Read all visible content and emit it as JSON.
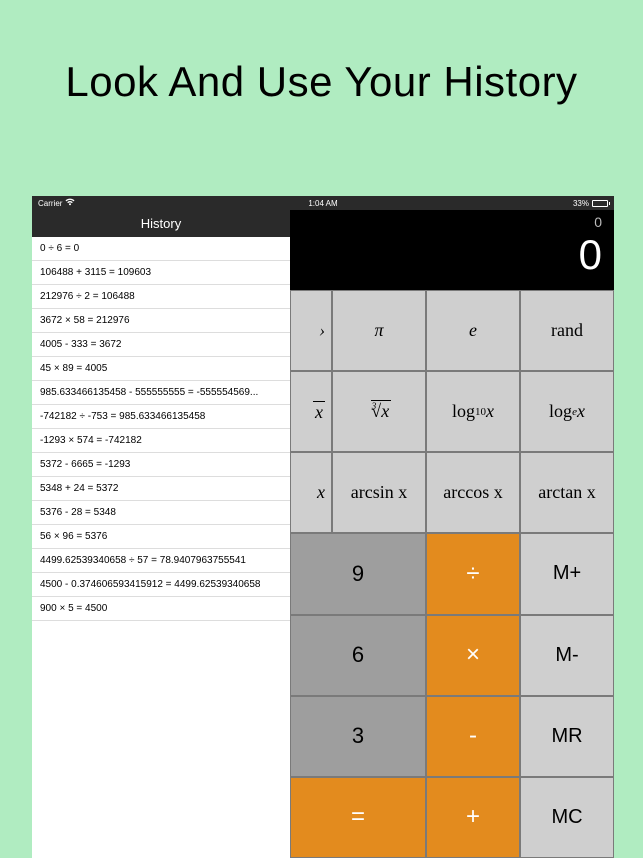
{
  "headline": "Look And Use Your History",
  "statusbar": {
    "carrier": "Carrier",
    "time": "1:04 AM",
    "battery_pct": "33%"
  },
  "history": {
    "title": "History",
    "items": [
      "0 ÷ 6 = 0",
      "106488 + 3115 = 109603",
      "212976 ÷ 2 = 106488",
      "3672 × 58 = 212976",
      "4005 - 333 = 3672",
      "45 × 89 = 4005",
      "985.633466135458 - 555555555 = -555554569...",
      "-742182 ÷ -753 = 985.633466135458",
      "-1293 × 574 = -742182",
      "5372 - 6665 = -1293",
      "5348 + 24 = 5372",
      "5376 - 28 = 5348",
      "56 × 96 = 5376",
      "4499.62539340658 ÷ 57 = 78.9407963755541",
      "4500 - 0.374606593415912 = 4499.62539340658",
      "900 × 5 = 4500"
    ]
  },
  "display": {
    "secondary": "0",
    "primary": "0"
  },
  "keys": {
    "partial1": "›",
    "pi": "π",
    "e": "e",
    "rand": "rand",
    "partial2_tail": "x",
    "cbrt_x": "x",
    "log10_pre": "log",
    "log10_sub": "10",
    "log10_x": " x",
    "loge_pre": "log",
    "loge_sub": "e",
    "loge_x": " x",
    "partial3_tail": "x",
    "arcsin": "arcsin x",
    "arccos": "arccos x",
    "arctan": "arctan x",
    "n9": "9",
    "div": "÷",
    "mplus": "M+",
    "n6": "6",
    "mul": "×",
    "mminus": "M-",
    "n3": "3",
    "sub": "-",
    "mr": "MR",
    "eq": "=",
    "add": "+",
    "mc": "MC"
  }
}
